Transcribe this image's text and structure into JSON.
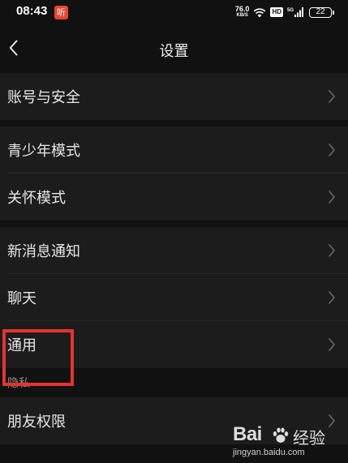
{
  "status_bar": {
    "time": "08:43",
    "notification_badge": "听",
    "net_speed_value": "76.0",
    "net_speed_unit": "KB/S",
    "hd_badge": "HD",
    "signal_type": "5G",
    "battery_level": "22"
  },
  "nav": {
    "title": "设置",
    "back_icon": "chevron-left-icon"
  },
  "groups": [
    {
      "items": [
        {
          "label": "账号与安全"
        }
      ]
    },
    {
      "items": [
        {
          "label": "青少年模式"
        },
        {
          "label": "关怀模式"
        }
      ]
    },
    {
      "items": [
        {
          "label": "新消息通知"
        },
        {
          "label": "聊天"
        },
        {
          "label": "通用"
        }
      ]
    },
    {
      "header": "隐私",
      "items": [
        {
          "label": "朋友权限"
        }
      ]
    }
  ],
  "highlighted_item": "通用",
  "colors": {
    "background": "#111111",
    "row_background": "#1c1c1c",
    "highlight": "#e8322e",
    "text": "#e8e8e8",
    "secondary_text": "#8a8a8a"
  },
  "watermark": {
    "brand": "Bai",
    "suffix": "经验",
    "url": "jingyan.baidu.com"
  }
}
